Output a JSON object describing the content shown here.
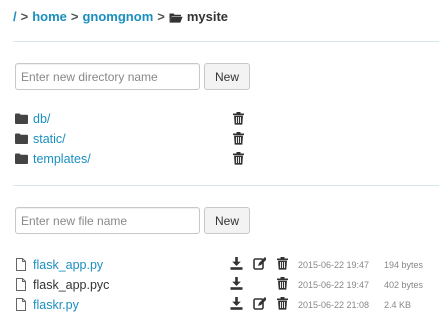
{
  "breadcrumb": {
    "root": "/",
    "sep": ">",
    "parts": [
      "home",
      "gnomgnom"
    ],
    "current": "mysite"
  },
  "directories": {
    "input_placeholder": "Enter new directory name",
    "new_label": "New",
    "items": [
      {
        "name": "db/"
      },
      {
        "name": "static/"
      },
      {
        "name": "templates/"
      }
    ]
  },
  "files": {
    "input_placeholder": "Enter new file name",
    "new_label": "New",
    "items": [
      {
        "name": "flask_app.py",
        "editable": true,
        "date": "2015-06-22 19:47",
        "size": "194 bytes"
      },
      {
        "name": "flask_app.pyc",
        "editable": false,
        "date": "2015-06-22 19:47",
        "size": "402 bytes"
      },
      {
        "name": "flaskr.py",
        "editable": true,
        "date": "2015-06-22 21:08",
        "size": "2.4 KB"
      }
    ]
  },
  "colors": {
    "link": "#1a8fbf",
    "divider": "#d6e8ea",
    "icon": "#333333",
    "muted": "#888888"
  },
  "icons": {
    "folder": "folder-icon",
    "file": "file-icon",
    "delete": "trash-icon",
    "download": "download-icon",
    "edit": "edit-icon"
  }
}
